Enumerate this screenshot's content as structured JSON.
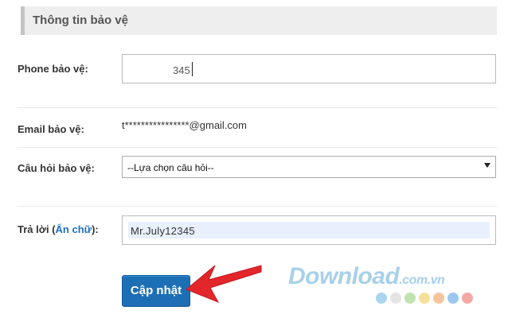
{
  "section": {
    "title": "Thông tin bảo vệ"
  },
  "phone": {
    "label": "Phone bảo vệ:",
    "value": "345"
  },
  "email": {
    "label": "Email bảo vệ:",
    "value": "t****************@gmail.com"
  },
  "question": {
    "label": "Câu hỏi bảo vệ:",
    "selected": "--Lựa chọn câu hỏi--"
  },
  "answer": {
    "label_prefix": "Trả lời (",
    "hide_link": "Ẩn chữ",
    "label_suffix": "):",
    "value": "Mr.July12345"
  },
  "update_button": {
    "label": "Cập nhật"
  },
  "watermark": {
    "main": "Download",
    "sub": ".com.vn"
  },
  "colors": {
    "accent": "#1d6fb5",
    "arrow": "#e3262b",
    "link": "#1a6fc0"
  },
  "dot_colors": [
    "#a9d4f2",
    "#e4e4e4",
    "#bfe3b0",
    "#f5e09a",
    "#f6c49a",
    "#9cc7ee",
    "#f3a8a8"
  ]
}
